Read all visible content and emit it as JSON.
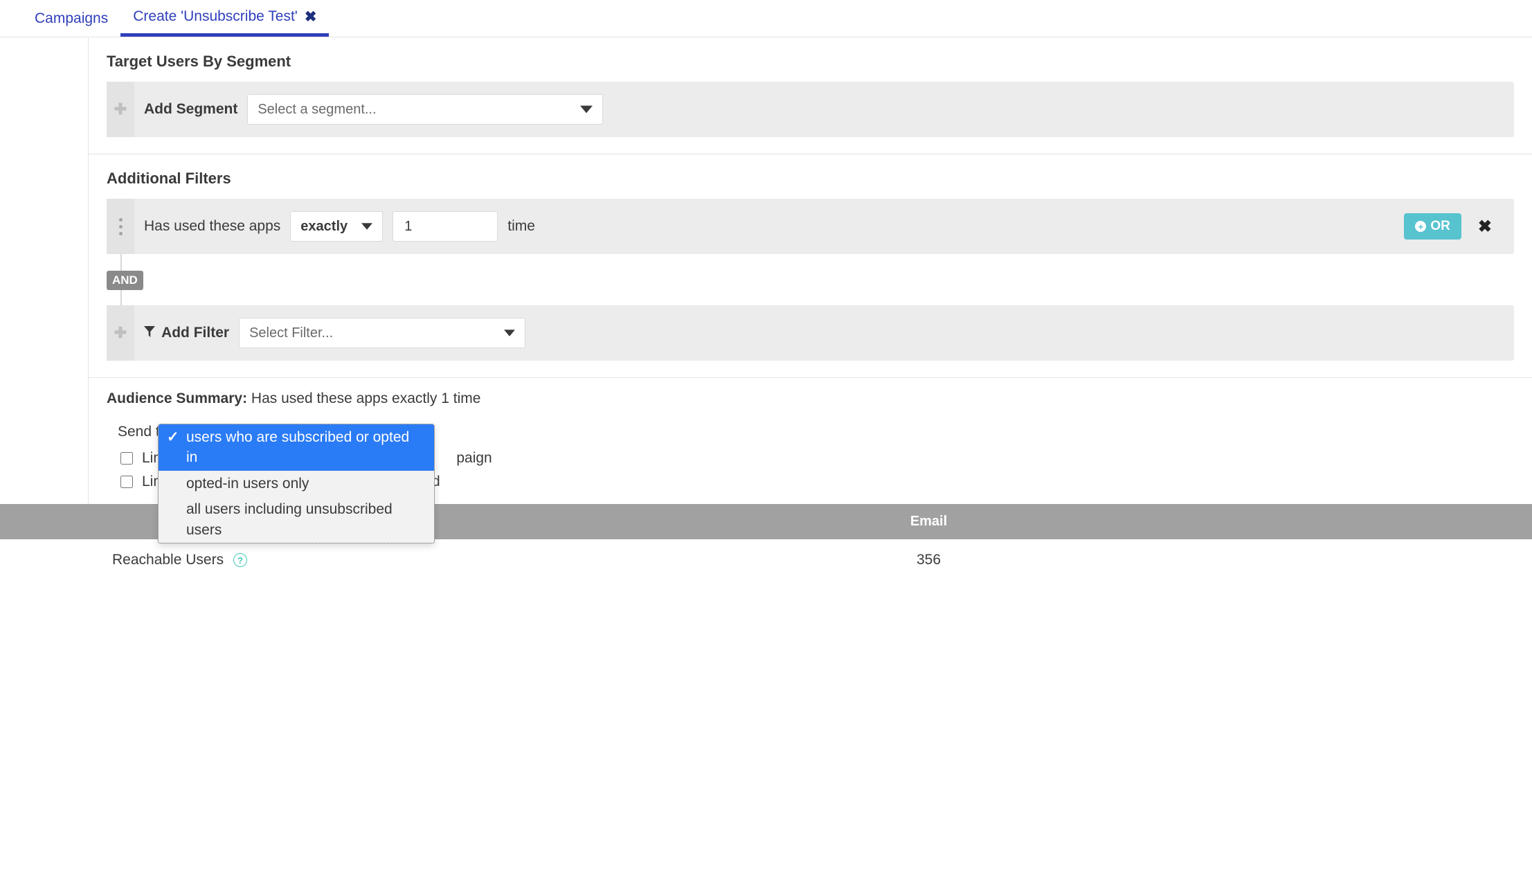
{
  "tabs": {
    "campaigns": "Campaigns",
    "create": "Create 'Unsubscribe Test'"
  },
  "segment": {
    "title": "Target Users By Segment",
    "add_label": "Add Segment",
    "placeholder": "Select a segment..."
  },
  "filters": {
    "title": "Additional Filters",
    "row_label": "Has used these apps",
    "operator": "exactly",
    "count": "1",
    "unit": "time",
    "or_label": "OR",
    "and_label": "AND",
    "add_filter_label": "Add Filter",
    "add_filter_placeholder": "Select Filter..."
  },
  "summary": {
    "label": "Audience Summary:",
    "text": "Has used these apps exactly 1 time",
    "send_to_label": "Send to",
    "behind_tail": "paign",
    "options": {
      "opt1": "users who are subscribed or opted in",
      "opt2": "opted-in users only",
      "opt3": "all users including unsubscribed users"
    },
    "limit_recipients": "Limit",
    "limit_rate": "Limit the rate at which this Campaign will send"
  },
  "reach": {
    "col_blank": "",
    "col_email": "Email",
    "row_label": "Reachable Users",
    "value": "356",
    "help": "?"
  }
}
